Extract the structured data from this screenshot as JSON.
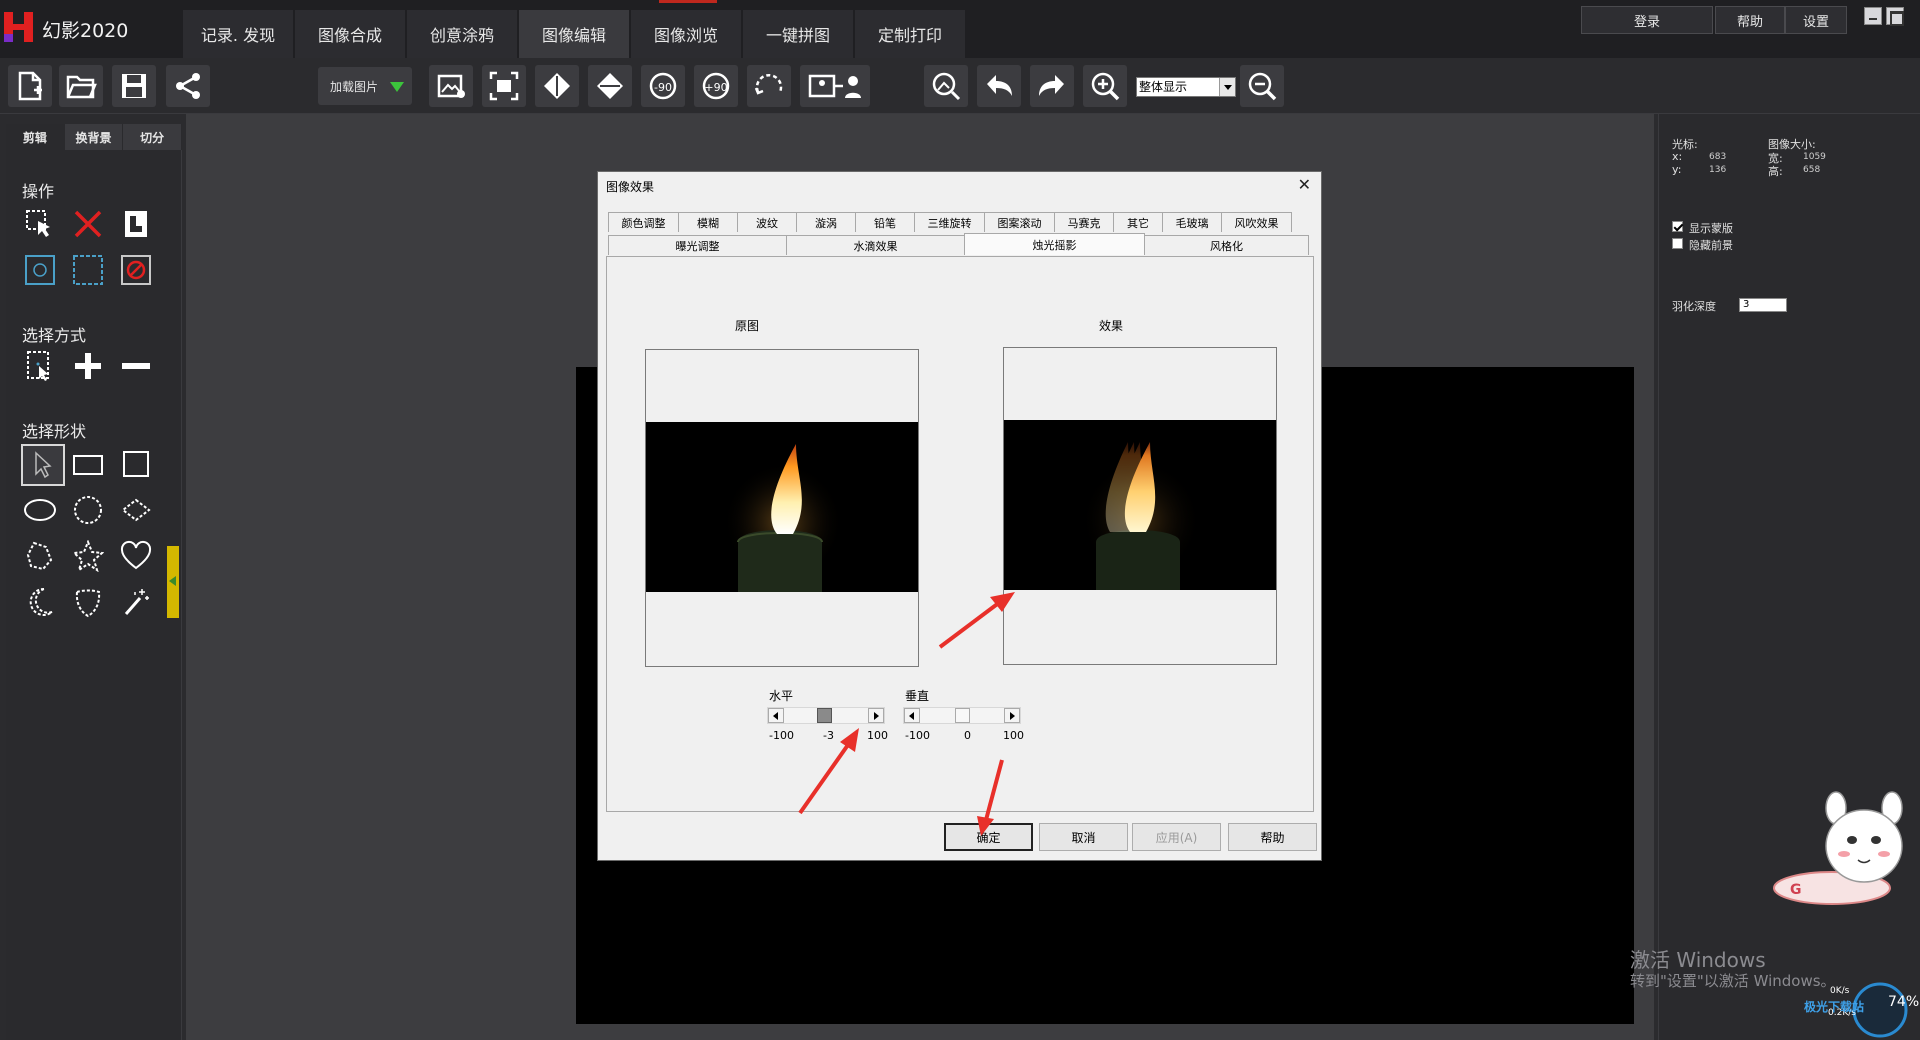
{
  "app": {
    "title": "幻影2020"
  },
  "main_menu": {
    "items": [
      "记录. 发现",
      "图像合成",
      "创意涂鸦",
      "图像编辑",
      "图像浏览",
      "一键拼图",
      "定制打印"
    ],
    "active_index": 3
  },
  "top_buttons": {
    "login": "登录",
    "help": "帮助",
    "settings": "设置"
  },
  "toolbar": {
    "load_image": "加载图片",
    "zoom_value": "整体显示",
    "icons": [
      "new-file-icon",
      "open-folder-icon",
      "save-icon",
      "share-icon",
      "crop-image-icon",
      "fit-frame-icon",
      "flip-horizontal-icon",
      "flip-vertical-icon",
      "rotate-minus-90-icon",
      "rotate-plus-90-icon",
      "free-rotate-icon",
      "person-replace-icon",
      "portrait-icon",
      "undo-icon",
      "redo-icon",
      "zoom-in-icon",
      "zoom-out-icon"
    ]
  },
  "left_panel": {
    "tabs": [
      "剪辑",
      "换背景",
      "切分"
    ],
    "active_tab": 0,
    "section_operations": "操作",
    "section_selection_mode": "选择方式",
    "section_selection_shape": "选择形状"
  },
  "right_panel": {
    "cursor_label": "光标:",
    "x_label": "x:",
    "x_value": "683",
    "y_label": "y:",
    "y_value": "136",
    "image_size_label": "图像大小:",
    "width_label": "宽:",
    "width_value": "1059",
    "height_label": "高:",
    "height_value": "658",
    "show_mask_label": "显示蒙版",
    "show_mask_checked": true,
    "hide_foreground_label": "隐藏前景",
    "hide_foreground_checked": false,
    "feather_label": "羽化深度",
    "feather_value": "3"
  },
  "dialog": {
    "title": "图像效果",
    "tabs_row1": [
      "颜色调整",
      "模糊",
      "波纹",
      "漩涡",
      "铅笔",
      "三维旋转",
      "图案滚动",
      "马赛克",
      "其它",
      "毛玻璃",
      "风吹效果"
    ],
    "tabs_row2": [
      "曝光调整",
      "水滴效果",
      "烛光摇影",
      "风格化"
    ],
    "active_tab": "烛光摇影",
    "original_label": "原图",
    "effect_label": "效果",
    "horizontal": {
      "label": "水平",
      "min": "-100",
      "value": "-3",
      "max": "100",
      "value_num": -3
    },
    "vertical": {
      "label": "垂直",
      "min": "-100",
      "value": "0",
      "max": "100",
      "value_num": 0
    },
    "buttons": {
      "ok": "确定",
      "cancel": "取消",
      "apply": "应用(A)",
      "help": "帮助"
    }
  },
  "watermark": {
    "title": "激活 Windows",
    "subtitle": "转到\"设置\"以激活 Windows。"
  },
  "network": {
    "up": "0K/s",
    "down": "0.2K/s",
    "percent": "74%",
    "site": "极光下载站"
  },
  "colors": {
    "accent": "#c0281e",
    "arrow": "#e8302a",
    "handle": "#d4b800"
  }
}
